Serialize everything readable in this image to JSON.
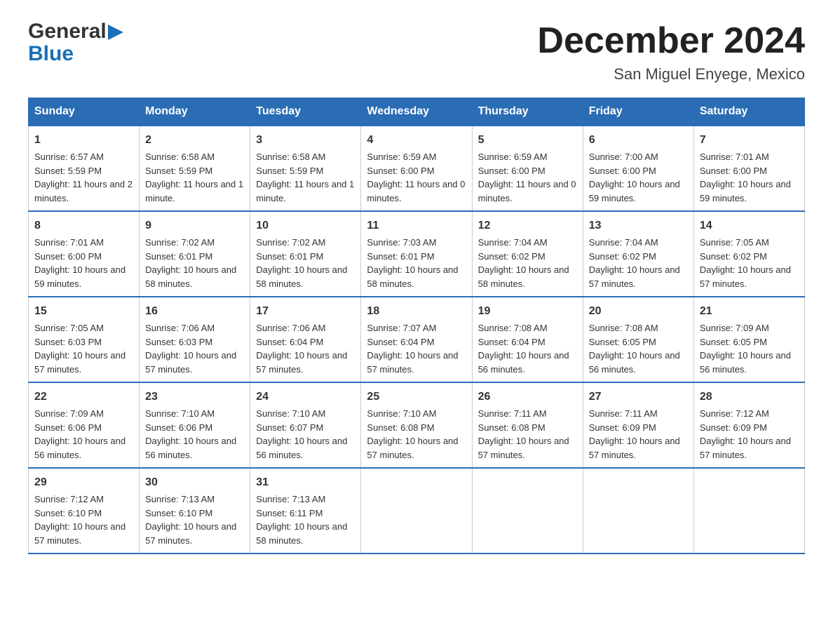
{
  "logo": {
    "text_general": "General",
    "text_blue": "Blue"
  },
  "title": "December 2024",
  "subtitle": "San Miguel Enyege, Mexico",
  "days_header": [
    "Sunday",
    "Monday",
    "Tuesday",
    "Wednesday",
    "Thursday",
    "Friday",
    "Saturday"
  ],
  "weeks": [
    [
      {
        "day": "1",
        "sunrise": "6:57 AM",
        "sunset": "5:59 PM",
        "daylight": "11 hours and 2 minutes."
      },
      {
        "day": "2",
        "sunrise": "6:58 AM",
        "sunset": "5:59 PM",
        "daylight": "11 hours and 1 minute."
      },
      {
        "day": "3",
        "sunrise": "6:58 AM",
        "sunset": "5:59 PM",
        "daylight": "11 hours and 1 minute."
      },
      {
        "day": "4",
        "sunrise": "6:59 AM",
        "sunset": "6:00 PM",
        "daylight": "11 hours and 0 minutes."
      },
      {
        "day": "5",
        "sunrise": "6:59 AM",
        "sunset": "6:00 PM",
        "daylight": "11 hours and 0 minutes."
      },
      {
        "day": "6",
        "sunrise": "7:00 AM",
        "sunset": "6:00 PM",
        "daylight": "10 hours and 59 minutes."
      },
      {
        "day": "7",
        "sunrise": "7:01 AM",
        "sunset": "6:00 PM",
        "daylight": "10 hours and 59 minutes."
      }
    ],
    [
      {
        "day": "8",
        "sunrise": "7:01 AM",
        "sunset": "6:00 PM",
        "daylight": "10 hours and 59 minutes."
      },
      {
        "day": "9",
        "sunrise": "7:02 AM",
        "sunset": "6:01 PM",
        "daylight": "10 hours and 58 minutes."
      },
      {
        "day": "10",
        "sunrise": "7:02 AM",
        "sunset": "6:01 PM",
        "daylight": "10 hours and 58 minutes."
      },
      {
        "day": "11",
        "sunrise": "7:03 AM",
        "sunset": "6:01 PM",
        "daylight": "10 hours and 58 minutes."
      },
      {
        "day": "12",
        "sunrise": "7:04 AM",
        "sunset": "6:02 PM",
        "daylight": "10 hours and 58 minutes."
      },
      {
        "day": "13",
        "sunrise": "7:04 AM",
        "sunset": "6:02 PM",
        "daylight": "10 hours and 57 minutes."
      },
      {
        "day": "14",
        "sunrise": "7:05 AM",
        "sunset": "6:02 PM",
        "daylight": "10 hours and 57 minutes."
      }
    ],
    [
      {
        "day": "15",
        "sunrise": "7:05 AM",
        "sunset": "6:03 PM",
        "daylight": "10 hours and 57 minutes."
      },
      {
        "day": "16",
        "sunrise": "7:06 AM",
        "sunset": "6:03 PM",
        "daylight": "10 hours and 57 minutes."
      },
      {
        "day": "17",
        "sunrise": "7:06 AM",
        "sunset": "6:04 PM",
        "daylight": "10 hours and 57 minutes."
      },
      {
        "day": "18",
        "sunrise": "7:07 AM",
        "sunset": "6:04 PM",
        "daylight": "10 hours and 57 minutes."
      },
      {
        "day": "19",
        "sunrise": "7:08 AM",
        "sunset": "6:04 PM",
        "daylight": "10 hours and 56 minutes."
      },
      {
        "day": "20",
        "sunrise": "7:08 AM",
        "sunset": "6:05 PM",
        "daylight": "10 hours and 56 minutes."
      },
      {
        "day": "21",
        "sunrise": "7:09 AM",
        "sunset": "6:05 PM",
        "daylight": "10 hours and 56 minutes."
      }
    ],
    [
      {
        "day": "22",
        "sunrise": "7:09 AM",
        "sunset": "6:06 PM",
        "daylight": "10 hours and 56 minutes."
      },
      {
        "day": "23",
        "sunrise": "7:10 AM",
        "sunset": "6:06 PM",
        "daylight": "10 hours and 56 minutes."
      },
      {
        "day": "24",
        "sunrise": "7:10 AM",
        "sunset": "6:07 PM",
        "daylight": "10 hours and 56 minutes."
      },
      {
        "day": "25",
        "sunrise": "7:10 AM",
        "sunset": "6:08 PM",
        "daylight": "10 hours and 57 minutes."
      },
      {
        "day": "26",
        "sunrise": "7:11 AM",
        "sunset": "6:08 PM",
        "daylight": "10 hours and 57 minutes."
      },
      {
        "day": "27",
        "sunrise": "7:11 AM",
        "sunset": "6:09 PM",
        "daylight": "10 hours and 57 minutes."
      },
      {
        "day": "28",
        "sunrise": "7:12 AM",
        "sunset": "6:09 PM",
        "daylight": "10 hours and 57 minutes."
      }
    ],
    [
      {
        "day": "29",
        "sunrise": "7:12 AM",
        "sunset": "6:10 PM",
        "daylight": "10 hours and 57 minutes."
      },
      {
        "day": "30",
        "sunrise": "7:13 AM",
        "sunset": "6:10 PM",
        "daylight": "10 hours and 57 minutes."
      },
      {
        "day": "31",
        "sunrise": "7:13 AM",
        "sunset": "6:11 PM",
        "daylight": "10 hours and 58 minutes."
      },
      null,
      null,
      null,
      null
    ]
  ]
}
